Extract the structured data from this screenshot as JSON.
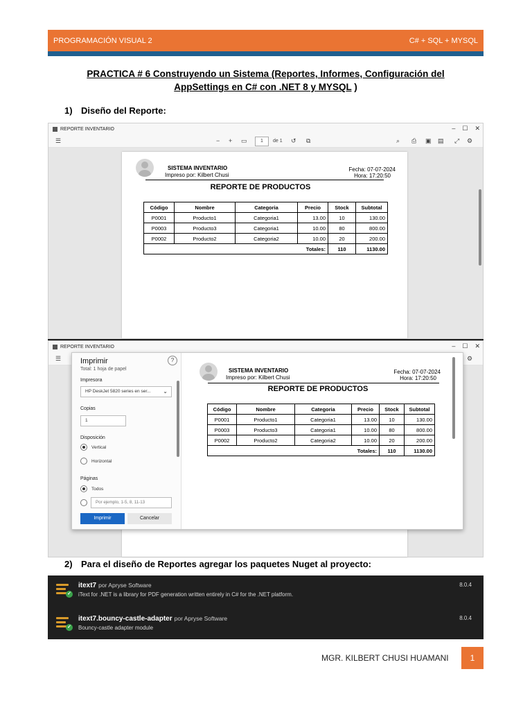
{
  "header": {
    "left": "PROGRAMACIÓN VISUAL 2",
    "right": "C# + SQL + MYSQL"
  },
  "title": {
    "part1": "PRACTICA # 6 Construyendo un Sistema (Reportes, Informes, Configuración del",
    "part2_u": "AppSettings en C# con .NET 8 y MYSQL",
    "part2_tail": " )"
  },
  "sections": [
    {
      "num": "1)",
      "text": "Diseño del Reporte:"
    },
    {
      "num": "2)",
      "text": "Para el diseño de Reportes agregar los paquetes Nuget al proyecto:"
    }
  ],
  "viewer": {
    "window_title": "REPORTE INVENTARIO",
    "controls": {
      "min": "–",
      "max": "☐",
      "close": "✕"
    },
    "toolbar": {
      "zoom_out": "−",
      "zoom_in": "+",
      "page": "1",
      "of_pages": "de 1"
    }
  },
  "report": {
    "system": "SISTEMA INVENTARIO",
    "printed_by": "Impreso por: Kilbert Chusi",
    "date": "Fecha: 07-07-2024",
    "time": "Hora: 17:20:50",
    "title": "REPORTE DE PRODUCTOS",
    "columns": [
      "Código",
      "Nombre",
      "Categoria",
      "Precio",
      "Stock",
      "Subtotal"
    ],
    "rows": [
      [
        "P0001",
        "Producto1",
        "Categoria1",
        "13.00",
        "10",
        "130.00"
      ],
      [
        "P0003",
        "Producto3",
        "Categoria1",
        "10.00",
        "80",
        "800.00"
      ],
      [
        "P0002",
        "Producto2",
        "Categoria2",
        "10.00",
        "20",
        "200.00"
      ]
    ],
    "totals_label": "Totales:",
    "total_stock": "110",
    "total_subtotal": "1130.00"
  },
  "print_dialog": {
    "heading": "Imprimir",
    "summary": "Total: 1 hoja de papel",
    "help": "?",
    "printer_label": "Impresora",
    "printer_value": "HP DeskJet 5820 series en ser...",
    "copies_label": "Copias",
    "copies_value": "1",
    "layout_label": "Disposición",
    "layout_options": [
      "Vertical",
      "Horizontal"
    ],
    "pages_label": "Páginas",
    "pages_all": "Todos",
    "pages_placeholder": "Por ejemplo, 1-5, 8, 11-13",
    "print_button": "Imprimir",
    "cancel_button": "Cancelar"
  },
  "nuget": [
    {
      "name": "itext7",
      "by": "por Apryse Software",
      "desc": "iText for .NET is a library for PDF generation written entirely in C# for the .NET platform.",
      "version": "8.0.4"
    },
    {
      "name": "itext7.bouncy-castle-adapter",
      "by": "por Apryse Software",
      "desc": "Bouncy-castle adapter module",
      "version": "8.0.4"
    }
  ],
  "footer": {
    "author": "MGR. KILBERT CHUSI HUAMANI",
    "page": "1"
  },
  "colors": {
    "accent": "#ea7433",
    "header_line": "#1f5f8f",
    "nuget_bg": "#1f1f1f",
    "print_button": "#1a67c4"
  }
}
